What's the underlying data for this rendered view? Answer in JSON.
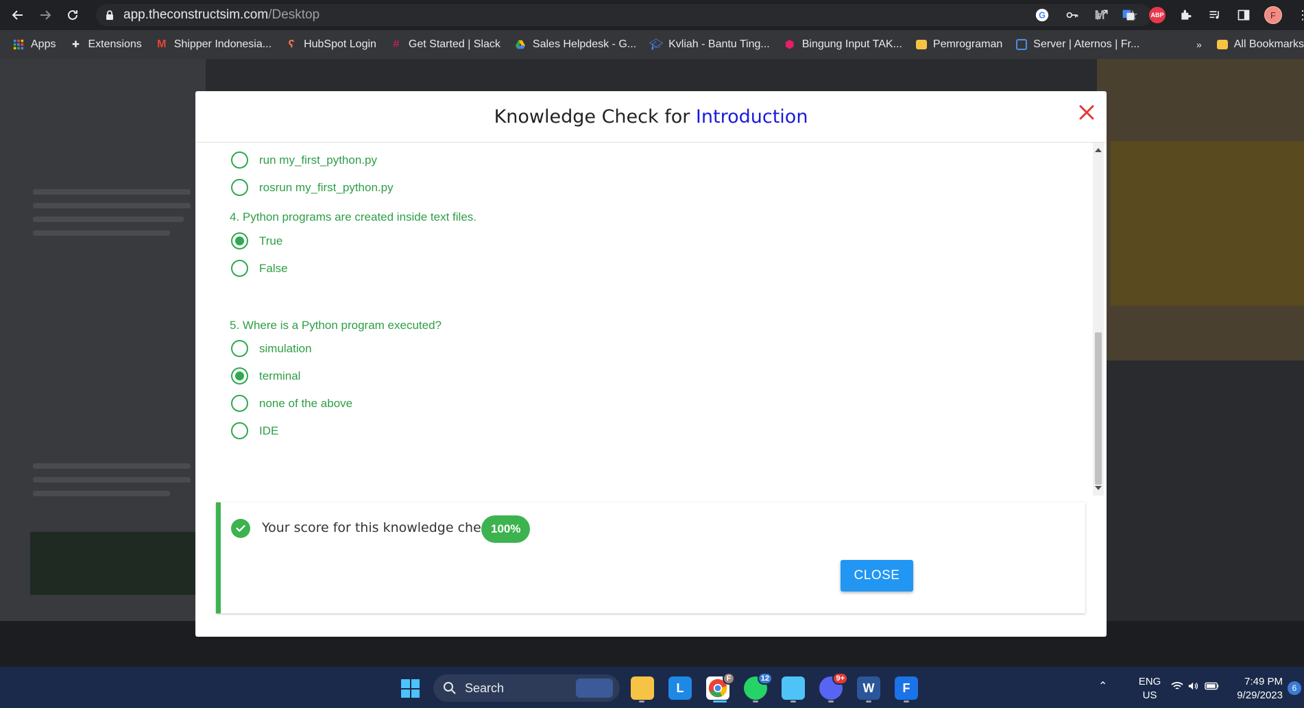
{
  "browser": {
    "url_host": "app.theconstructsim.com",
    "url_path": "/Desktop",
    "profile_initial": "F",
    "abp_label": "ABP"
  },
  "bookmarks": {
    "items": [
      {
        "label": "Apps",
        "icon": "apps-grid-icon"
      },
      {
        "label": "Extensions",
        "icon": "puzzle-icon"
      },
      {
        "label": "Shipper Indonesia...",
        "icon": "gmail-icon"
      },
      {
        "label": "HubSpot Login",
        "icon": "hubspot-icon"
      },
      {
        "label": "Get Started | Slack",
        "icon": "slack-icon"
      },
      {
        "label": "Sales Helpdesk - G...",
        "icon": "drive-icon"
      },
      {
        "label": "Kvliah - Bantu Ting...",
        "icon": "graduation-cap-icon"
      },
      {
        "label": "Bingung Input TAK...",
        "icon": "hexagon-icon"
      },
      {
        "label": "Pemrograman",
        "icon": "folder-icon"
      },
      {
        "label": "Server | Aternos | Fr...",
        "icon": "aternos-icon"
      }
    ],
    "overflow": "»",
    "all_bookmarks": "All Bookmarks"
  },
  "modal": {
    "title_prefix": "Knowledge Check for ",
    "title_topic": "Introduction",
    "question3_options": [
      {
        "label": "run my_first_python.py",
        "checked": false
      },
      {
        "label": "rosrun my_first_python.py",
        "checked": false
      }
    ],
    "question4": {
      "text": "4. Python programs are created inside text files.",
      "options": [
        {
          "label": "True",
          "checked": true
        },
        {
          "label": "False",
          "checked": false
        }
      ]
    },
    "question5": {
      "text": "5. Where is a Python program executed?",
      "options": [
        {
          "label": "simulation",
          "checked": false
        },
        {
          "label": "terminal",
          "checked": true
        },
        {
          "label": "none of the above",
          "checked": false
        },
        {
          "label": "IDE",
          "checked": false
        }
      ]
    },
    "score_text": "Your score for this knowledge check:",
    "score_value": "100%",
    "close_button": "CLOSE"
  },
  "taskbar": {
    "search_label": "Search",
    "chrome_badge": "F",
    "whatsapp_badge": "12",
    "discord_badge": "9+",
    "lang_line1": "ENG",
    "lang_line2": "US",
    "time": "7:49 PM",
    "date": "9/29/2023",
    "notification_count": "6"
  },
  "colors": {
    "accent_green": "#2e9e45",
    "title_accent": "#1a1adc",
    "close_x": "#e53935",
    "button_blue": "#2196f3"
  }
}
